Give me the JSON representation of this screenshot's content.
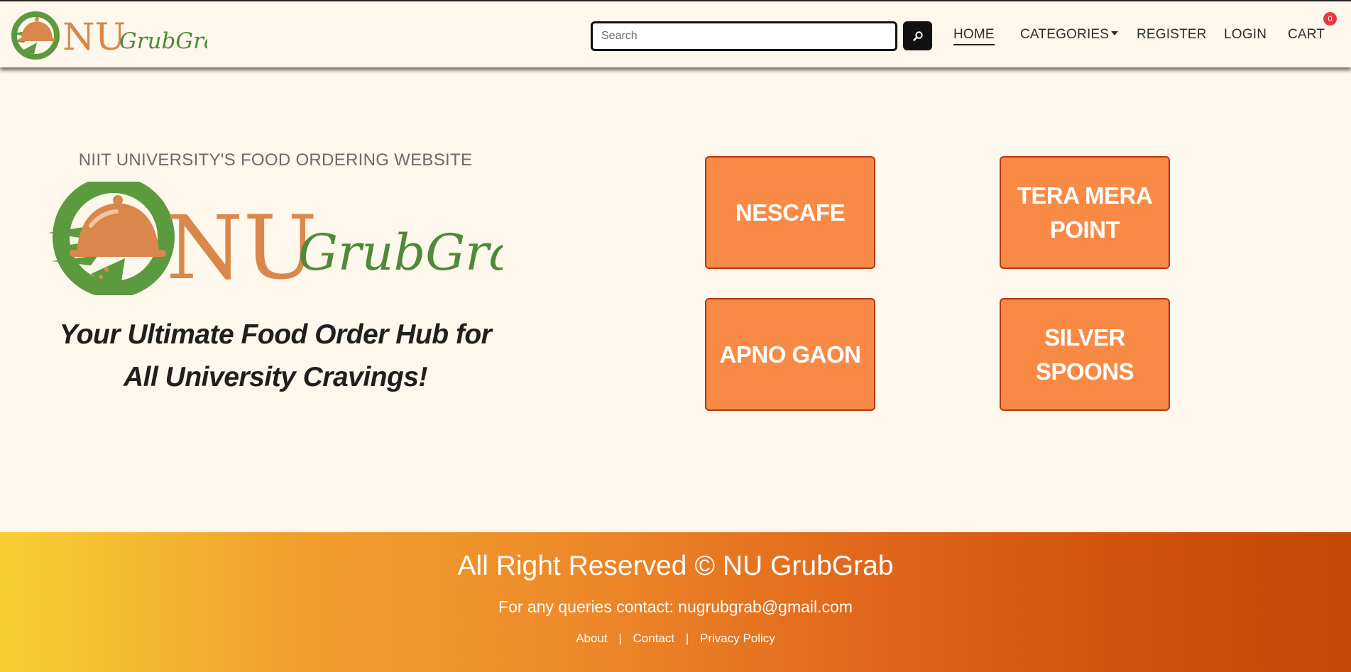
{
  "brand": {
    "logo_nu": "NU",
    "logo_grubgrab": "GrubGrab",
    "colors": {
      "logo_orange": "#d9874a",
      "logo_green": "#5b9a3e",
      "accent": "#f98a45"
    }
  },
  "search": {
    "placeholder": "Search",
    "button_icon": "search-icon"
  },
  "nav": {
    "home": "HOME",
    "categories": "CATEGORIES",
    "register": "REGISTER",
    "login": "LOGIN",
    "cart": "CART",
    "cart_count": "0"
  },
  "hero": {
    "tagline": "NIIT UNIVERSITY'S FOOD ORDERING WEBSITE",
    "headline_line1": "Your Ultimate Food Order Hub for",
    "headline_line2": "All University Cravings!"
  },
  "restaurants": [
    {
      "name": "NESCAFE"
    },
    {
      "name": "TERA MERA POINT"
    },
    {
      "name": "APNO GAON"
    },
    {
      "name": "SILVER SPOONS"
    }
  ],
  "footer": {
    "copyright": "All Right Reserved © NU GrubGrab",
    "contact": "For any queries contact: nugrubgrab@gmail.com",
    "links": {
      "about": "About",
      "contact": "Contact",
      "privacy": "Privacy Policy"
    },
    "separator": "|"
  }
}
